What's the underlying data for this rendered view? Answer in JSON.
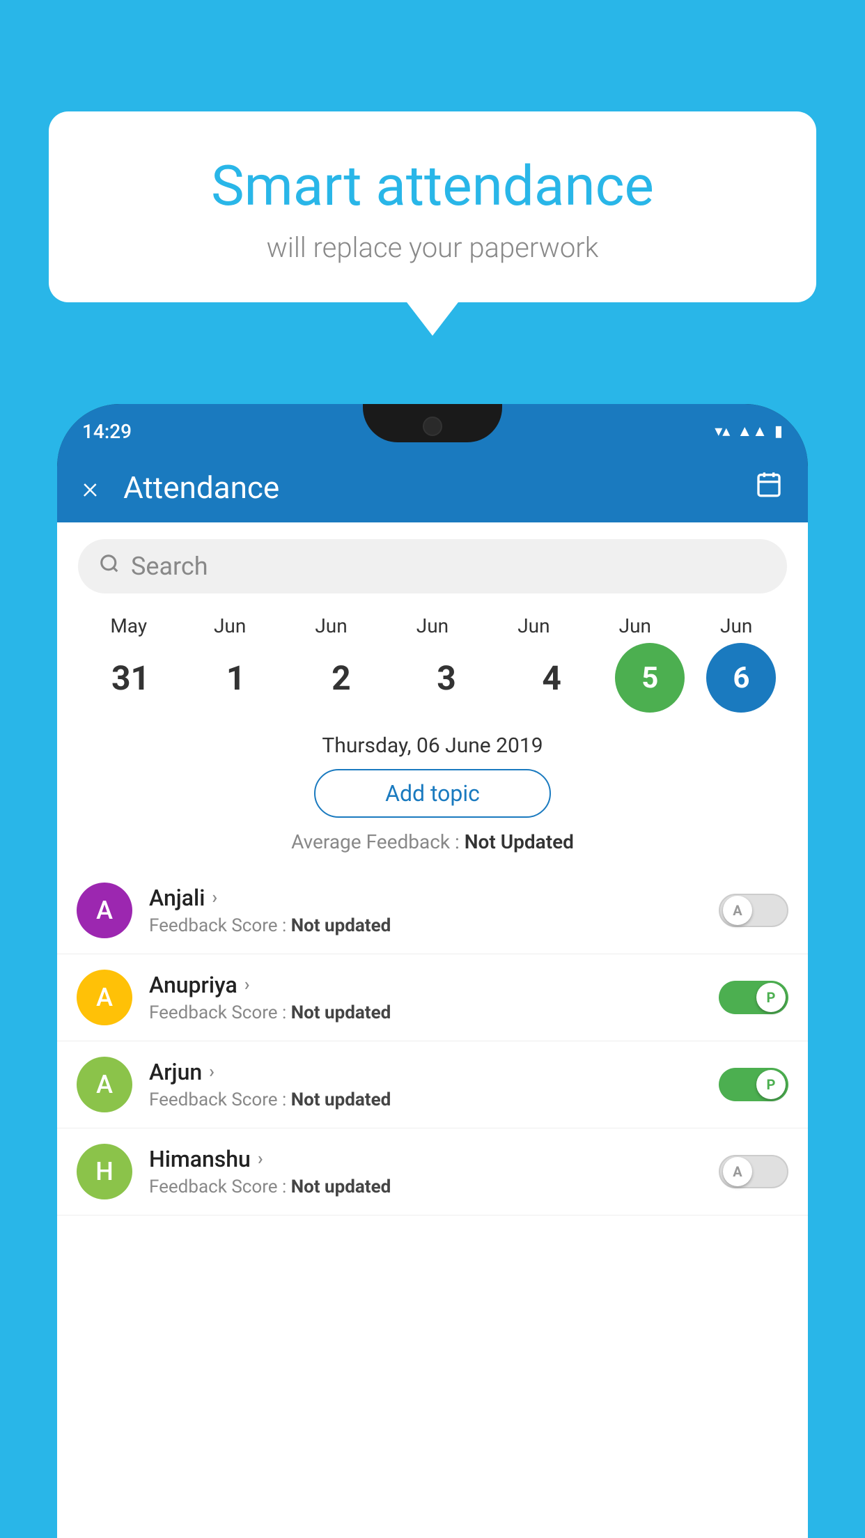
{
  "background_color": "#29b6e8",
  "speech_bubble": {
    "title": "Smart attendance",
    "subtitle": "will replace your paperwork"
  },
  "status_bar": {
    "time": "14:29",
    "icons": [
      "wifi",
      "signal",
      "battery"
    ]
  },
  "app_bar": {
    "close_label": "×",
    "title": "Attendance",
    "calendar_icon": "📅"
  },
  "search": {
    "placeholder": "Search"
  },
  "calendar": {
    "months": [
      "May",
      "Jun",
      "Jun",
      "Jun",
      "Jun",
      "Jun",
      "Jun"
    ],
    "days": [
      "31",
      "1",
      "2",
      "3",
      "4",
      "5",
      "6"
    ],
    "selected_date": "Thursday, 06 June 2019",
    "today_green_index": 5,
    "today_blue_index": 6
  },
  "add_topic": {
    "label": "Add topic"
  },
  "avg_feedback": {
    "label": "Average Feedback :",
    "value": "Not Updated"
  },
  "students": [
    {
      "name": "Anjali",
      "initial": "A",
      "avatar_color": "#9c27b0",
      "feedback_label": "Feedback Score :",
      "feedback_value": "Not updated",
      "toggle_state": "off",
      "toggle_label": "A"
    },
    {
      "name": "Anupriya",
      "initial": "A",
      "avatar_color": "#ffc107",
      "feedback_label": "Feedback Score :",
      "feedback_value": "Not updated",
      "toggle_state": "on",
      "toggle_label": "P"
    },
    {
      "name": "Arjun",
      "initial": "A",
      "avatar_color": "#8bc34a",
      "feedback_label": "Feedback Score :",
      "feedback_value": "Not updated",
      "toggle_state": "on",
      "toggle_label": "P"
    },
    {
      "name": "Himanshu",
      "initial": "H",
      "avatar_color": "#8bc34a",
      "feedback_label": "Feedback Score :",
      "feedback_value": "Not updated",
      "toggle_state": "off",
      "toggle_label": "A"
    }
  ]
}
